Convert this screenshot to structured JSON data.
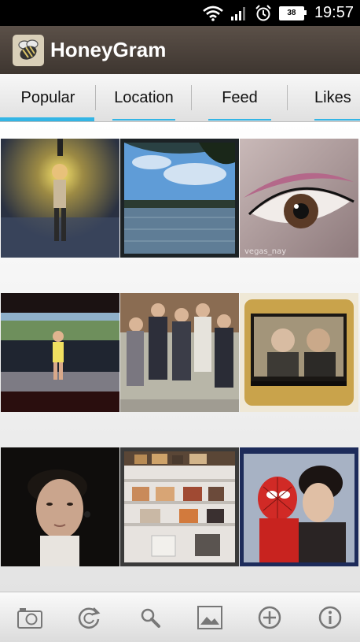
{
  "status_bar": {
    "time": "19:57",
    "battery_level": "38",
    "icons": [
      "wifi-icon",
      "signal-icon",
      "alarm-icon",
      "battery-icon"
    ]
  },
  "app": {
    "title": "HoneyGram",
    "logo_icon": "bee-logo-icon"
  },
  "tabs": [
    {
      "label": "Popular",
      "selected": true
    },
    {
      "label": "Location",
      "selected": false
    },
    {
      "label": "Feed",
      "selected": false
    },
    {
      "label": "Likes",
      "selected": false
    }
  ],
  "photos": [
    {
      "subject": "person standing under a lamp at night"
    },
    {
      "subject": "lake view framed by trees"
    },
    {
      "subject": "close-up of an eye with glitter makeup",
      "watermark": "vegas_nay"
    },
    {
      "subject": "woman in front of a police line"
    },
    {
      "subject": "group of young men in suits"
    },
    {
      "subject": "two people on a TV screen"
    },
    {
      "subject": "selfie of a young man"
    },
    {
      "subject": "shelves of handbags"
    },
    {
      "subject": "child in a spider mask with a woman"
    }
  ],
  "toolbar": [
    "camera-icon",
    "refresh-icon",
    "search-icon",
    "gallery-icon",
    "add-icon",
    "info-icon"
  ],
  "colors": {
    "accent": "#33b5e5",
    "appbar": "#4a413a",
    "statusbar": "#000000"
  }
}
